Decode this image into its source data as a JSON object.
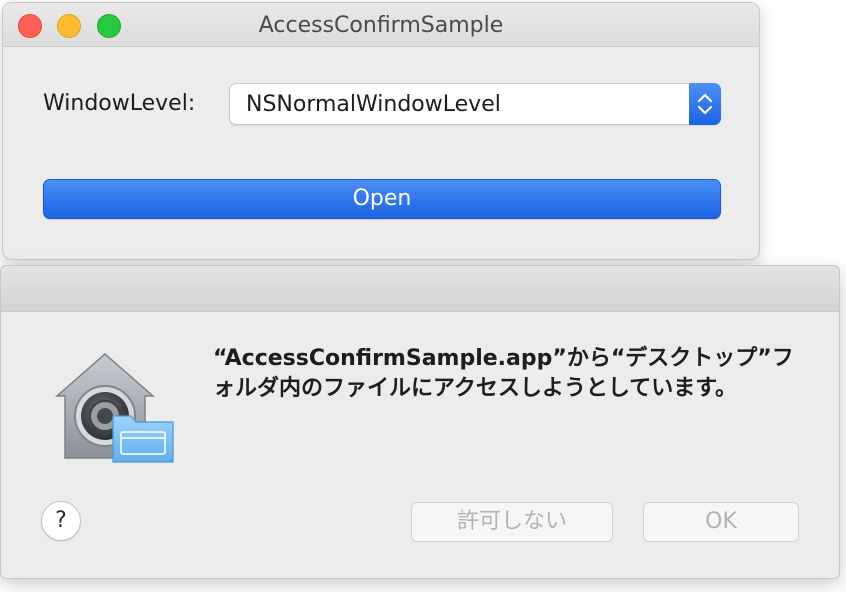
{
  "main_window": {
    "title": "AccessConfirmSample",
    "window_level_label": "WindowLevel:",
    "window_level_value": "NSNormalWindowLevel",
    "open_label": "Open"
  },
  "alert": {
    "message": "“AccessConfirmSample.app”から“デスクトップ”フォルダ内のファイルにアクセスしようとしています。",
    "help_label": "?",
    "deny_label": "許可しない",
    "ok_label": "OK"
  },
  "colors": {
    "accent": "#1c64e3",
    "close": "#fe5f57",
    "minimize": "#febc2e",
    "zoom": "#28c840"
  },
  "icons": [
    "security-lock-icon",
    "folder-icon",
    "chevron-up-down-icon"
  ]
}
